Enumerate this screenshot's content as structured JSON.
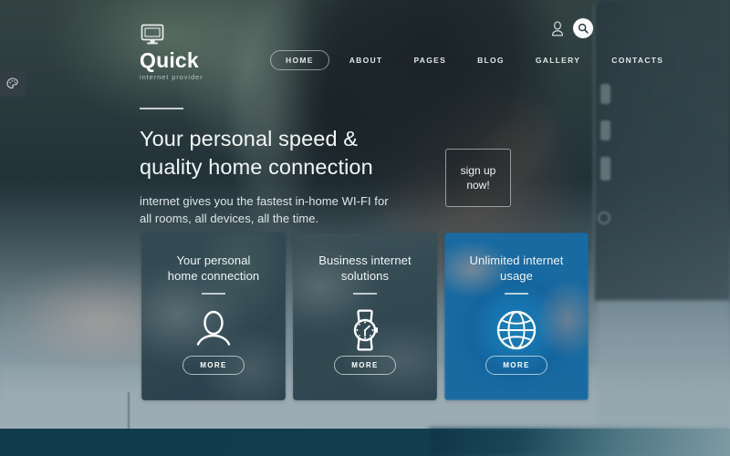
{
  "brand": {
    "name": "Quick",
    "tagline": "internet provider",
    "logo_icon": "monitor-icon"
  },
  "theme": {
    "accent": "#1d86c4",
    "footer": "#133d4e",
    "text_light": "#f2f6f5"
  },
  "sidebar_tab": {
    "icon": "palette-icon",
    "label": "palette"
  },
  "header": {
    "nav": [
      {
        "label": "HOME",
        "active": true
      },
      {
        "label": "ABOUT",
        "active": false
      },
      {
        "label": "PAGES",
        "active": false
      },
      {
        "label": "BLOG",
        "active": false
      },
      {
        "label": "GALLERY",
        "active": false
      },
      {
        "label": "CONTACTS",
        "active": false
      }
    ],
    "account_icon": "user-icon",
    "search_icon": "search-icon"
  },
  "hero": {
    "title_line1": "Your personal speed &",
    "title_line2": "quality home connection",
    "subtitle_line1": "internet gives you the fastest in-home WI-FI for",
    "subtitle_line2": "all rooms, all devices, all the time.",
    "cta_line1": "sign up",
    "cta_line2": "now!"
  },
  "cards": [
    {
      "title_line1": "Your personal",
      "title_line2": "home connection",
      "icon": "person-icon",
      "button": "MORE"
    },
    {
      "title_line1": "Business internet",
      "title_line2": "solutions",
      "icon": "watch-icon",
      "button": "MORE"
    },
    {
      "title_line1": "Unlimited internet",
      "title_line2": "usage",
      "icon": "globe-icon",
      "button": "MORE"
    }
  ]
}
